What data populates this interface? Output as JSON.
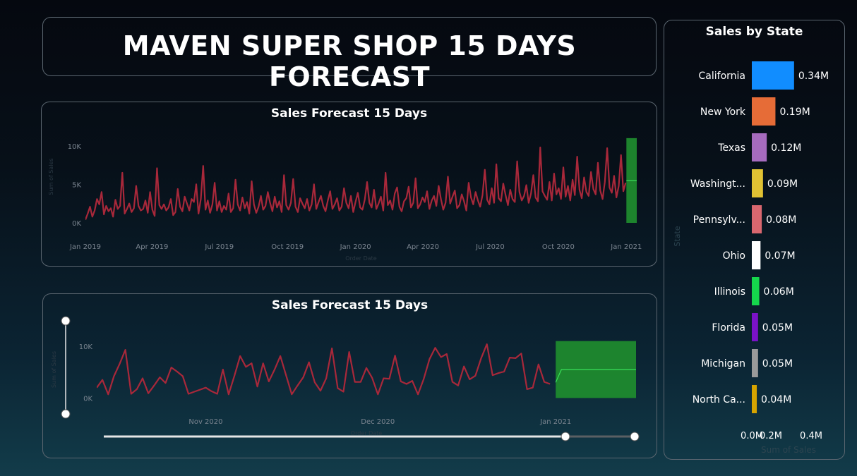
{
  "title": "MAVEN SUPER SHOP 15 DAYS FORECAST",
  "chart_data": [
    {
      "type": "line",
      "title": "Sales Forecast 15 Days",
      "xlabel": "Order Date",
      "ylabel": "Sum of Sales",
      "x_ticks": [
        "Jan 2019",
        "Apr 2019",
        "Jul 2019",
        "Oct 2019",
        "Jan 2020",
        "Apr 2020",
        "Jul 2020",
        "Oct 2020",
        "Jan 2021"
      ],
      "y_ticks": [
        "0K",
        "5K",
        "10K"
      ],
      "x_range": [
        "2019-01-01",
        "2021-01-15"
      ],
      "ylim": [
        0,
        12000
      ],
      "series": [
        {
          "name": "",
          "color": "#a8283a",
          "x_start": "2019-01-01",
          "x_end": "2020-12-31",
          "values": [
            400,
            1200,
            2100,
            800,
            1600,
            3100,
            2400,
            4000,
            1100,
            2200,
            1500,
            1900,
            800,
            3000,
            1800,
            2200,
            6500,
            1200,
            1800,
            2500,
            1400,
            1900,
            4800,
            2200,
            1600,
            1800,
            2900,
            1300,
            4000,
            1700,
            900,
            7100,
            2300,
            1800,
            2400,
            1600,
            2000,
            3100,
            1000,
            1400,
            4400,
            2100,
            1500,
            3400,
            2500,
            1600,
            3100,
            2700,
            5000,
            1200,
            3100,
            7400,
            1700,
            2900,
            1300,
            2400,
            5200,
            1600,
            2800,
            1400,
            2200,
            1700,
            3800,
            1400,
            1900,
            5600,
            2400,
            1600,
            3300,
            1900,
            2700,
            1200,
            5400,
            2400,
            1300,
            2100,
            3500,
            1700,
            2200,
            4000,
            2600,
            1500,
            3400,
            2000,
            2800,
            1400,
            6200,
            2300,
            1700,
            2600,
            5700,
            2100,
            1400,
            3200,
            2500,
            1900,
            3100,
            1600,
            2400,
            5000,
            1800,
            2700,
            3500,
            2200,
            1500,
            2900,
            4100,
            1800,
            2400,
            3200,
            1600,
            2100,
            4500,
            2600,
            1900,
            3500,
            1400,
            2700,
            3900,
            2000,
            1700,
            3000,
            5300,
            2600,
            2000,
            4300,
            1800,
            2500,
            3400,
            1600,
            6500,
            2300,
            2900,
            1700,
            3800,
            4600,
            2100,
            1500,
            2800,
            3200,
            4700,
            2000,
            2600,
            5800,
            1900,
            2400,
            3300,
            2700,
            4100,
            1800,
            2900,
            3500,
            2200,
            4800,
            3100,
            1700,
            2600,
            6000,
            2500,
            3400,
            4200,
            1900,
            2300,
            3700,
            2800,
            1600,
            5200,
            3300,
            2400,
            4000,
            2900,
            2100,
            3600,
            6900,
            3000,
            2400,
            4500,
            2600,
            7600,
            3200,
            2800,
            5100,
            3600,
            2300,
            4300,
            3100,
            2700,
            8000,
            4000,
            2900,
            3500,
            4900,
            2600,
            3800,
            6200,
            3300,
            2800,
            9800,
            4100,
            3500,
            3000,
            5300,
            2900,
            6400,
            3700,
            4500,
            3100,
            7200,
            3400,
            4800,
            2900,
            5600,
            3600,
            8600,
            4300,
            3200,
            5900,
            4000,
            3500,
            6600,
            4400,
            3700,
            7800,
            4200,
            3100,
            5300,
            9700,
            4600,
            3900,
            6100,
            3300,
            4800,
            8800,
            4100,
            5200
          ]
        },
        {
          "name": "forecast",
          "color": "#1f8a2e",
          "x_start": "2021-01-01",
          "x_end": "2021-01-15",
          "values": [
            5500,
            5500,
            5500,
            5500,
            5500,
            5500,
            5500,
            5500,
            5500,
            5500,
            5500,
            5500,
            5500,
            5500,
            5500
          ],
          "upper": 11000,
          "lower": 0
        }
      ]
    },
    {
      "type": "line",
      "title": "Sales Forecast 15 Days",
      "xlabel": "Order Date",
      "ylabel": "Sum of Sales",
      "x_ticks": [
        "Nov 2020",
        "Dec 2020",
        "Jan 2021"
      ],
      "y_ticks": [
        "0K",
        "10K"
      ],
      "x_range": [
        "2020-10-13",
        "2021-01-15"
      ],
      "ylim": [
        -5000,
        16000
      ],
      "series": [
        {
          "name": "",
          "color": "#a8283a",
          "x_start": "2020-10-13",
          "x_end": "2020-12-31",
          "values": [
            2000,
            3500,
            700,
            4200,
            6600,
            9300,
            800,
            1700,
            3800,
            900,
            2400,
            4000,
            2900,
            5900,
            5100,
            4200,
            800,
            1200,
            1600,
            2000,
            1300,
            800,
            5500,
            700,
            4300,
            8100,
            6000,
            6700,
            2200,
            6700,
            3200,
            5500,
            8100,
            4400,
            700,
            2400,
            4000,
            6900,
            3000,
            1400,
            3800,
            9600,
            1900,
            1200,
            8900,
            3100,
            3100,
            5800,
            3900,
            700,
            3800,
            3700,
            8200,
            3200,
            2700,
            3300,
            700,
            3700,
            7500,
            9700,
            7900,
            8500,
            3100,
            2400,
            6100,
            3600,
            4300,
            7700,
            10400,
            4400,
            4800,
            5100,
            7800,
            7700,
            8600,
            1700,
            2000,
            6500,
            3100,
            2700
          ]
        },
        {
          "name": "forecast",
          "color": "#1f8a2e",
          "x_start": "2021-01-01",
          "x_end": "2021-01-15",
          "values": [
            3000,
            5500,
            5500,
            5500,
            5500,
            5500,
            5500,
            5500,
            5500,
            5500,
            5500,
            5500,
            5500,
            5500,
            5500
          ],
          "upper": 11000,
          "lower": 0
        }
      ]
    },
    {
      "type": "bar",
      "orientation": "horizontal",
      "title": "Sales by State",
      "xlabel": "Sum of Sales",
      "ylabel": "State",
      "x_ticks": [
        "0.0M",
        "0.2M",
        "0.4M"
      ],
      "xlim": [
        0,
        0.4
      ],
      "categories": [
        "California",
        "New York",
        "Texas",
        "Washingt...",
        "Pennsylv...",
        "Ohio",
        "Illinois",
        "Florida",
        "Michigan",
        "North Ca..."
      ],
      "values": [
        0.34,
        0.19,
        0.12,
        0.09,
        0.08,
        0.07,
        0.06,
        0.05,
        0.05,
        0.04
      ],
      "value_labels": [
        "0.34M",
        "0.19M",
        "0.12M",
        "0.09M",
        "0.08M",
        "0.07M",
        "0.06M",
        "0.05M",
        "0.05M",
        "0.04M"
      ],
      "colors": [
        "#118dff",
        "#e66c37",
        "#a66bbe",
        "#e1c233",
        "#d9676f",
        "#ffffff",
        "#15d64c",
        "#7a12c8",
        "#9a9a9a",
        "#d6a400"
      ]
    }
  ]
}
